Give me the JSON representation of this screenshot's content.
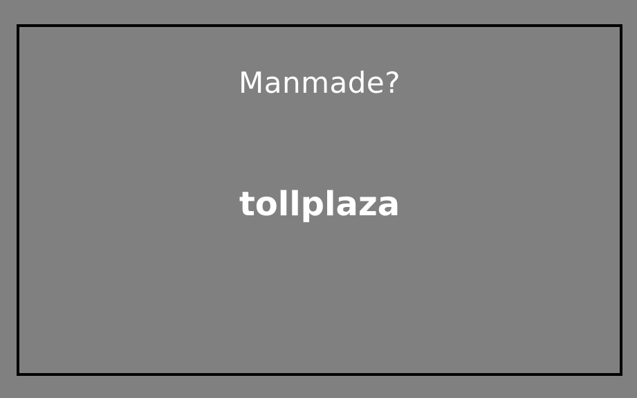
{
  "stimulus": {
    "question": "Manmade?",
    "word": "tollplaza"
  },
  "colors": {
    "background": "#808080",
    "frame_border": "#000000",
    "text": "#ffffff"
  }
}
